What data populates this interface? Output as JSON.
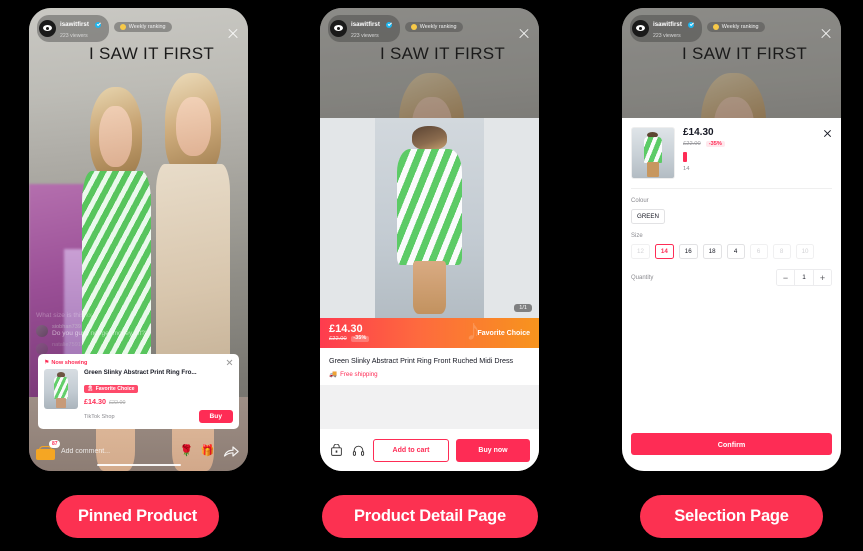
{
  "live": {
    "host_name": "isawitfirst",
    "viewers": "223 viewers",
    "ranking_badge": "Weekly ranking",
    "brand_watermark": "I SAW IT FIRST",
    "close_label": "close-icon"
  },
  "comments": [
    {
      "user": "",
      "text": "What size is this xx"
    },
    {
      "user": "siobhan739",
      "text": "Do you guys not get money off?!"
    },
    {
      "user": "natalie75912",
      "text": ""
    }
  ],
  "pinned_card": {
    "now_showing": "Now showing",
    "title": "Green Slinky Abstract Print Ring Fro...",
    "badge": "Favorite Choice",
    "price": "£14.30",
    "old_price": "£22.00",
    "shop": "TikTok Shop",
    "buy_label": "Buy"
  },
  "live_bottom": {
    "cart_badge": "87",
    "comment_placeholder": "Add comment...",
    "rose_icon": "rose-icon",
    "gift_icon": "gift-icon",
    "share_icon": "share-icon"
  },
  "pdp": {
    "pager": "1/1",
    "price": "£14.30",
    "old_price": "£22.00",
    "discount": "-35%",
    "favorite_label": "Favorite Choice",
    "title": "Green Slinky Abstract Print Ring Front Ruched Midi Dress",
    "shipping": "Free shipping",
    "add_to_cart": "Add to cart",
    "buy_now": "Buy now",
    "shop_icon": "shop-icon",
    "support_icon": "headset-icon"
  },
  "selection": {
    "price": "£14.30",
    "old_price": "£22.00",
    "discount": "-35%",
    "selected_size_note": "14",
    "colour_label": "Colour",
    "colours": [
      {
        "label": "GREEN",
        "state": "default"
      }
    ],
    "size_label": "Size",
    "sizes": [
      {
        "label": "12",
        "state": "disabled"
      },
      {
        "label": "14",
        "state": "selected"
      },
      {
        "label": "16",
        "state": "default"
      },
      {
        "label": "18",
        "state": "default"
      },
      {
        "label": "4",
        "state": "default"
      },
      {
        "label": "6",
        "state": "disabled"
      },
      {
        "label": "8",
        "state": "disabled"
      },
      {
        "label": "10",
        "state": "disabled"
      }
    ],
    "quantity_label": "Quantity",
    "quantity_value": "1",
    "minus_label": "−",
    "plus_label": "+",
    "confirm_label": "Confirm"
  },
  "captions": {
    "pinned": "Pinned Product",
    "detail": "Product Detail Page",
    "selection": "Selection Page"
  },
  "colors": {
    "accent": "#fe2c55",
    "pill": "#fc3151",
    "background": "#000000",
    "gradient_start": "#fe3b4e",
    "gradient_end": "#f7941d"
  }
}
